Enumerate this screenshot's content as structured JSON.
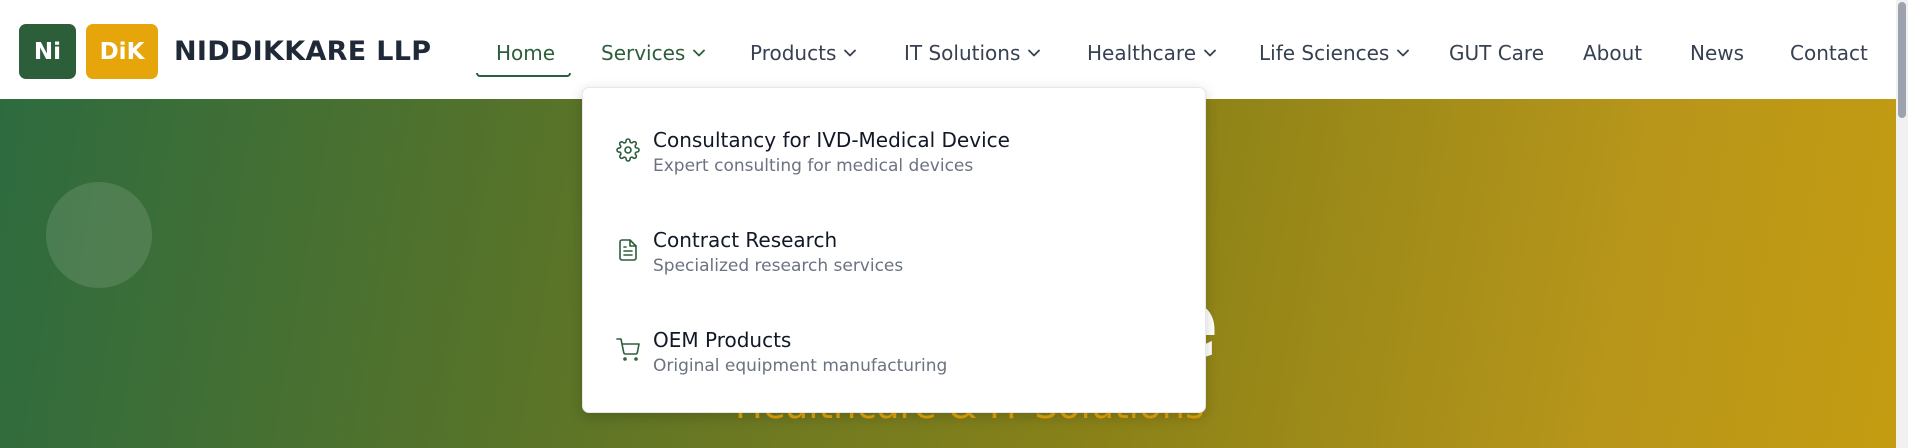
{
  "brand": {
    "badge_left": "Ni",
    "badge_right": "DiK",
    "name": "NIDDIKKARE LLP"
  },
  "nav": {
    "items": [
      {
        "label": "Home",
        "active": true,
        "dropdown": false
      },
      {
        "label": "Services",
        "active": false,
        "dropdown": true,
        "open": true
      },
      {
        "label": "Products",
        "active": false,
        "dropdown": true
      },
      {
        "label": "IT Solutions",
        "active": false,
        "dropdown": true
      },
      {
        "label": "Healthcare",
        "active": false,
        "dropdown": true
      },
      {
        "label": "Life Sciences",
        "active": false,
        "dropdown": true
      },
      {
        "label": "GUT Care",
        "active": false,
        "dropdown": false
      },
      {
        "label": "About",
        "active": false,
        "dropdown": false
      },
      {
        "label": "News",
        "active": false,
        "dropdown": false
      },
      {
        "label": "Contact",
        "active": false,
        "dropdown": false
      }
    ]
  },
  "services_menu": {
    "items": [
      {
        "icon": "gear-icon",
        "title": "Consultancy for IVD-Medical Device",
        "description": "Expert consulting for medical devices"
      },
      {
        "icon": "document-icon",
        "title": "Contract Research",
        "description": "Specialized research services"
      },
      {
        "icon": "cart-icon",
        "title": "OEM Products",
        "description": "Original equipment manufacturing"
      }
    ]
  },
  "hero": {
    "title_visible": "re",
    "subtitle": "Healthcare & IT Solutions"
  },
  "colors": {
    "brand_green": "#2d5e3a",
    "brand_gold": "#e6a50a",
    "text_dark": "#1f2937",
    "text_muted": "#6b7280"
  }
}
